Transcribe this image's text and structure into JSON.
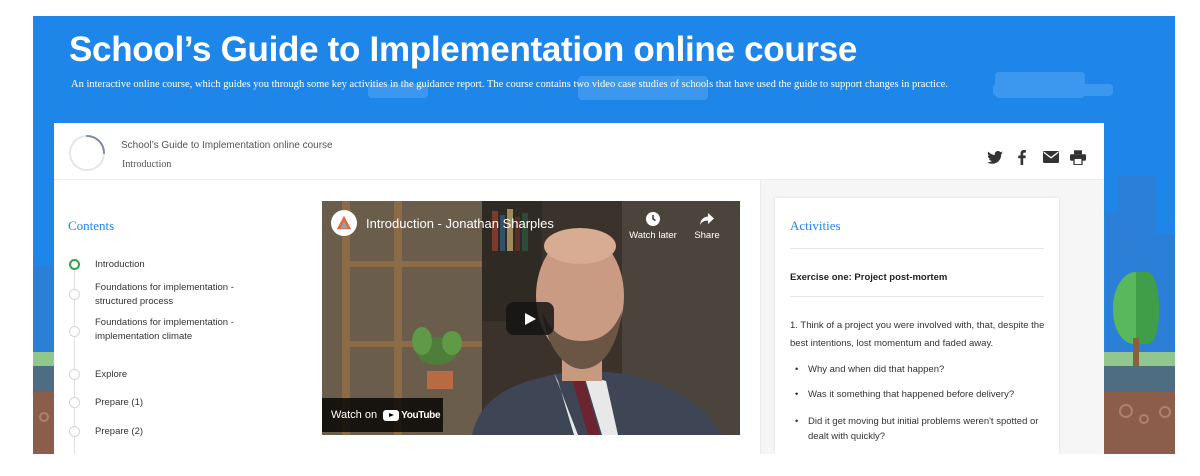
{
  "header": {
    "title": "School’s Guide to Implementation online course",
    "subtitle": "An interactive online course, which guides you through some key activities in the guidance report. The course contains two video case studies of schools that have used the guide to support changes in practice."
  },
  "course_bar": {
    "course_name": "School’s Guide to Implementation online course",
    "section_name": "Introduction",
    "progress_fraction": 0.25,
    "share_icons": [
      "twitter-icon",
      "facebook-icon",
      "email-icon",
      "print-icon"
    ]
  },
  "contents": {
    "title": "Contents",
    "items": [
      {
        "label": "Introduction",
        "active": true
      },
      {
        "label": "Foundations for implementation - structured process",
        "active": false
      },
      {
        "label": "Foundations for implementation - implementation climate",
        "active": false
      },
      {
        "label": "Explore",
        "active": false
      },
      {
        "label": "Prepare (1)",
        "active": false
      },
      {
        "label": "Prepare (2)",
        "active": false
      }
    ]
  },
  "video": {
    "title": "Introduction - Jonathan Sharples",
    "watch_later": "Watch later",
    "share": "Share",
    "watch_on": "Watch on",
    "youtube": "YouTube"
  },
  "activities": {
    "title": "Activities",
    "exercise_title": "Exercise one: Project post-mortem",
    "question": "1. Think of a project you were involved with, that, despite the best intentions, lost momentum and faded away.",
    "bullets": [
      "Why and when did that happen?",
      "Was it something that happened before delivery?",
      "Did it get moving but initial problems weren't spotted or dealt with quickly?"
    ]
  },
  "colors": {
    "brand_blue": "#1f86e9",
    "active_green": "#28a745"
  }
}
